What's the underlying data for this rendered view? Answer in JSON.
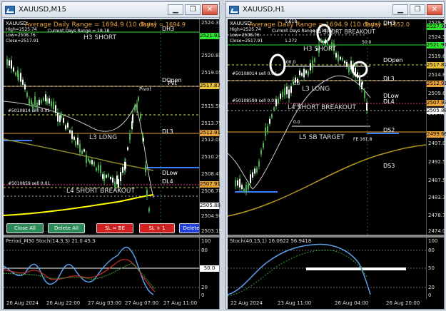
{
  "colors": {
    "green_line": "#2ee62e",
    "orange": "#e8a23a",
    "pink": "#e23a8a",
    "white_candle": "#ffffff",
    "bear_candle": "#4caf50"
  },
  "left": {
    "title": "XAUUSD,M15",
    "hdr_symbol": "XAUUSD",
    "adr_text": "Average Daily Range = 1694.9 (10 days)",
    "today_text": "Today = 1694.9",
    "stats": [
      "High=2525.74",
      "Low=2508.76",
      "Close=2517.91"
    ],
    "range_text": "Current Days Range = 18.18",
    "labels": {
      "dh3": "DH3",
      "h3short": "H3 SHORT",
      "pivot": "Pivot",
      "dopen": "DOpen",
      "pvt": "Pvt",
      "dl3": "DL3",
      "l3long": "L3 LONG",
      "dlow": "DLow",
      "dl4": "DL4",
      "l4sb": "L4 SHORT BREAKOUT",
      "sell1": "#5010814 sell 0.01",
      "sell2": "#5010859 sell 0.01"
    },
    "prices": [
      "2524.35",
      "2520.85",
      "2519.05",
      "2515.50",
      "2513.75",
      "2512.00",
      "2510.25",
      "2508.45",
      "2506.70",
      "2504.90",
      "2503.15"
    ],
    "price_tags": [
      "2521.91",
      "2517.87",
      "2512.91",
      "2507.91",
      "2505.88"
    ],
    "buttons": [
      "Close All",
      "Delete All",
      "SL = BE",
      "SL + 1",
      "Delete"
    ],
    "sub_title": "Period_M30 Stoch(14,3,3) 21.0 45.3",
    "sub_scale": [
      "100",
      "80",
      "50.0",
      "20",
      "0"
    ],
    "times": [
      "26 Aug 2024",
      "26 Aug 22:00",
      "27 Aug 03:00",
      "27 Aug 07:00",
      "27 Aug 11:00"
    ]
  },
  "right": {
    "title": "XAUUSD,H1",
    "hdr_symbol": "XAUUSD",
    "adr_text": "Average Daily Range = 1694.9 (10 days)",
    "today_text": "Today = 1652.0",
    "stats": [
      "High=2525.74",
      "Low=2508.76",
      "Close=2517.91"
    ],
    "range_text": "Current Days Range = 18.52",
    "labels": {
      "dh3": "DH3",
      "h3short": "H3 SHORT",
      "h4sb": "H4 SHORT BREAKOUT",
      "dopen": "DOpen",
      "dl3": "DL3",
      "l3long": "L3 LONG",
      "dlow": "DLow",
      "dl4": "DL4",
      "l4sb": "L4 SHORT BREAKOUT",
      "l5": "L5 SB TARGET",
      "fe": "FE 161.8",
      "ds2": "DS2",
      "ds3": "DS3",
      "sell1": "#50108014 sell 0.01",
      "sell2": "#50108599 sell 0.01"
    },
    "prices": [
      "2529.50",
      "2524.55",
      "2519.60",
      "2514.85",
      "2509.65",
      "2504.75",
      "2497.05",
      "2492.50",
      "2487.55",
      "2483.30",
      "2478.70",
      "2474.00"
    ],
    "price_tags": [
      "2527.91",
      "2521.91",
      "2517.87",
      "2512.91",
      "2507.93",
      "2505.88",
      "2499.66"
    ],
    "levels": [
      "1.618",
      "1.272",
      "50.0",
      "100.0",
      "0.0",
      "0.0",
      "0.0"
    ],
    "sub_title": "Stoch(40,15,1) 16.0622 56.9418",
    "sub_scale": [
      "100",
      "80",
      "50",
      "20",
      "0"
    ],
    "times": [
      "22 Aug 2024",
      "23 Aug 11:00",
      "26 Aug 04:00",
      "26 Aug 20:00"
    ]
  }
}
